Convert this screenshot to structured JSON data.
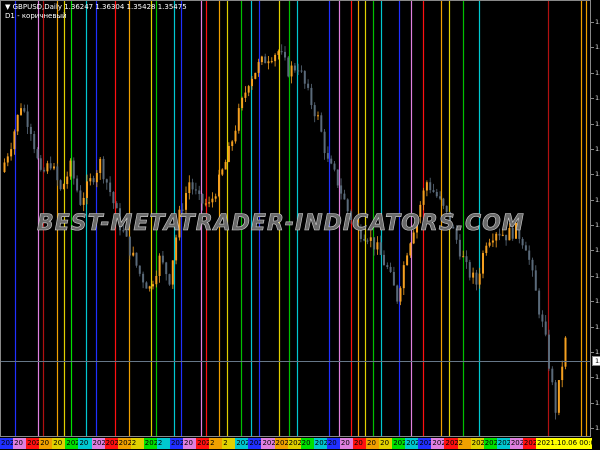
{
  "header": {
    "symbol_line": "GBPUSD,Daily  1.36247 1.36304 1.35428 1.35475",
    "indicator_line": "D1 - коричневый"
  },
  "watermark": "BEST-METATRADER-INDICATORS.COM",
  "price_axis": {
    "labels": [
      "1.42480",
      "1.41950",
      "1.41430",
      "1.40900",
      "1.40380",
      "1.39860",
      "1.39330",
      "1.38810",
      "1.38280",
      "1.37760",
      "1.37230",
      "1.36710",
      "1.36180",
      "1.35660",
      "1.35140",
      "1.34610",
      "1.34090"
    ],
    "current_price": "1.35475"
  },
  "colors": {
    "bull": "#f5a020",
    "bear": "#5a6a7a",
    "current_line": "#667788"
  },
  "closes": [
    1.394,
    1.4,
    1.408,
    1.403,
    1.393,
    1.396,
    1.39,
    1.395,
    1.388,
    1.392,
    1.396,
    1.39,
    1.383,
    1.378,
    1.373,
    1.37,
    1.376,
    1.372,
    1.385,
    1.392,
    1.388,
    1.387,
    1.392,
    1.398,
    1.406,
    1.413,
    1.416,
    1.418,
    1.419,
    1.415,
    1.416,
    1.41,
    1.405,
    1.396,
    1.392,
    1.386,
    1.382,
    1.381,
    1.378,
    1.374,
    1.368,
    1.378,
    1.385,
    1.392,
    1.389,
    1.385,
    1.38,
    1.374,
    1.371,
    1.38,
    1.382,
    1.381,
    1.382,
    1.379,
    1.369,
    1.359,
    1.345,
    1.359
  ],
  "vlines": [
    {
      "color": "#2030ff"
    },
    {
      "color": "#e080e0"
    },
    {
      "color": "#b01010"
    },
    {
      "color": "#f0a000"
    },
    {
      "color": "#e0d000"
    },
    {
      "color": "#00e000"
    },
    {
      "color": "#00c8d0"
    },
    {
      "color": "#2030ff"
    },
    {
      "color": "#ff1010"
    },
    {
      "color": "#f0a000"
    },
    {
      "color": "#e0d000"
    },
    {
      "color": "#00c000"
    },
    {
      "color": "#00c8d0"
    },
    {
      "color": "#2030ff"
    },
    {
      "color": "#e080e0"
    },
    {
      "color": "#ff1010"
    },
    {
      "color": "#f0a000"
    },
    {
      "color": "#e0d000"
    },
    {
      "color": "#00c000"
    },
    {
      "color": "#00c8d0"
    },
    {
      "color": "#2030ff"
    },
    {
      "color": "#e0d000"
    },
    {
      "color": "#00c000"
    },
    {
      "color": "#00c8d0"
    },
    {
      "color": "#2030ff"
    },
    {
      "color": "#e080e0"
    },
    {
      "color": "#ff1010"
    },
    {
      "color": "#f0a000"
    },
    {
      "color": "#e0d000"
    },
    {
      "color": "#00c000"
    },
    {
      "color": "#00c8d0"
    },
    {
      "color": "#2030ff"
    },
    {
      "color": "#e080e0"
    },
    {
      "color": "#ff1010"
    },
    {
      "color": "#f0a000"
    },
    {
      "color": "#e0d000"
    },
    {
      "color": "#00c000"
    },
    {
      "color": "#00c8d0"
    },
    {
      "color": "#b01010"
    },
    {
      "color": "#f0a000"
    },
    {
      "color": "#f0a000"
    }
  ],
  "date_labels": [
    {
      "text": "2021.0",
      "bg": "#2030ff"
    },
    {
      "text": "20",
      "bg": "#e080e0"
    },
    {
      "text": "2021.",
      "bg": "#ff1010"
    },
    {
      "text": "20",
      "bg": "#f0a000"
    },
    {
      "text": "20",
      "bg": "#e0d000"
    },
    {
      "text": "2021.",
      "bg": "#00e000"
    },
    {
      "text": "20",
      "bg": "#00c8d0"
    },
    {
      "text": "2021.",
      "bg": "#e080e0"
    },
    {
      "text": "2021",
      "bg": "#ff1010"
    },
    {
      "text": "2021.0",
      "bg": "#f0a000"
    },
    {
      "text": "2",
      "bg": "#e0d000"
    },
    {
      "text": "2021",
      "bg": "#00e000"
    },
    {
      "text": "2",
      "bg": "#00c8d0"
    },
    {
      "text": "2021.0",
      "bg": "#2030ff"
    },
    {
      "text": "20",
      "bg": "#e080e0"
    },
    {
      "text": "202",
      "bg": "#ff1010"
    },
    {
      "text": "2",
      "bg": "#f0a000"
    },
    {
      "text": "2",
      "bg": "#e0d000"
    },
    {
      "text": "202",
      "bg": "#00c8d0"
    },
    {
      "text": "202",
      "bg": "#2030ff"
    },
    {
      "text": "202",
      "bg": "#e080e0"
    },
    {
      "text": "2021.",
      "bg": "#f0a000"
    },
    {
      "text": "2021.0",
      "bg": "#e0d000"
    },
    {
      "text": "20",
      "bg": "#00e000"
    },
    {
      "text": "2021.",
      "bg": "#00c8d0"
    },
    {
      "text": "20",
      "bg": "#2030ff"
    },
    {
      "text": "20",
      "bg": "#e080e0"
    },
    {
      "text": "20",
      "bg": "#ff1010"
    },
    {
      "text": "20",
      "bg": "#f0a000"
    },
    {
      "text": "20",
      "bg": "#e0d000"
    },
    {
      "text": "2021",
      "bg": "#00e000"
    },
    {
      "text": "2021.",
      "bg": "#00c8d0"
    },
    {
      "text": "2021.08.0",
      "bg": "#2030ff"
    },
    {
      "text": "2021",
      "bg": "#e080e0"
    },
    {
      "text": "2021.08.2",
      "bg": "#ff1010"
    },
    {
      "text": "2",
      "bg": "#f0a000"
    },
    {
      "text": "202",
      "bg": "#e0d000"
    },
    {
      "text": "2021",
      "bg": "#00e000"
    },
    {
      "text": "2021.09",
      "bg": "#00c8d0"
    },
    {
      "text": "2021.",
      "bg": "#e080e0"
    },
    {
      "text": "2021",
      "bg": "#ff1010"
    },
    {
      "text": "2021.10.06 00:00",
      "bg": "#ffff00"
    }
  ]
}
